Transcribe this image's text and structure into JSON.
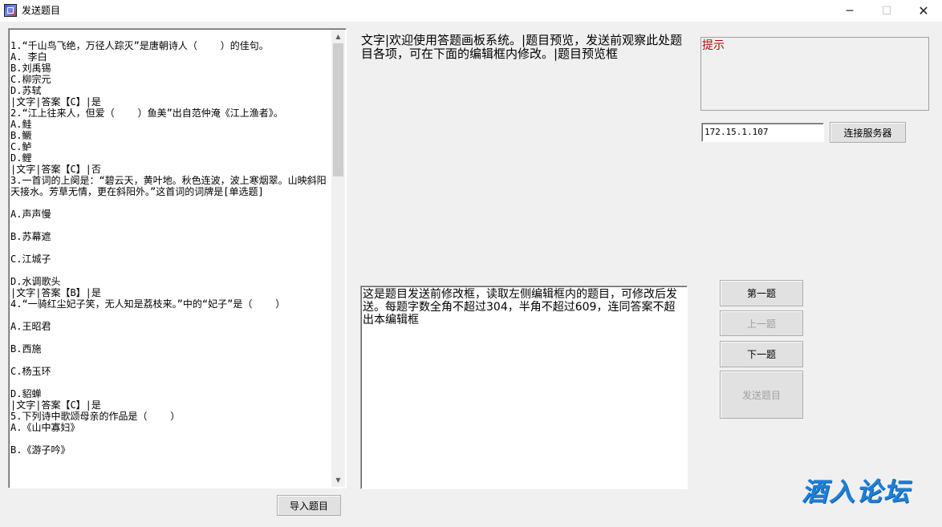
{
  "window": {
    "title": "发送题目",
    "minimize_glyph": "─",
    "maximize_glyph": "☐",
    "close_glyph": "✕",
    "app_icon": "app-icon"
  },
  "question_list": {
    "text": "1.“千山鸟飞绝，万径人踪灭”是唐朝诗人（    ）的佳句。\nA. 李白\nB.刘禹锡\nC.柳宗元\nD.苏轼\n|文字|答案【C】|是\n2.“江上往来人，但爱（    ）鱼美”出自范仲淹《江上渔者》。\nA.鲑\nB.鳜\nC.鲈\nD.鲤\n|文字|答案【C】|否\n3.一首词的上阕是：“碧云天，黄叶地。秋色连波，波上寒烟翠。山映斜阳天接水。芳草无情，更在斜阳外。”这首词的词牌是[单选题]\n\nA.声声慢\n\nB.苏幕遮\n\nC.江城子\n\nD.水调歌头\n|文字|答案【B】|是\n4.“一骑红尘妃子笑，无人知是荔枝来。”中的“妃子”是（    ）\n\nA.王昭君\n\nB.西施\n\nC.杨玉环\n\nD.貂蝉\n|文字|答案【C】|是\n5.下列诗中歌颂母亲的作品是（    ）\nA.《山中寡妇》\n\nB.《游子吟》"
  },
  "scrollbar": {
    "up_glyph": "▲",
    "down_glyph": "▼"
  },
  "import_button": {
    "label": "导入题目"
  },
  "info": {
    "text": "文字|欢迎使用答题画板系统。|题目预览，发送前观察此处题目各项，可在下面的编辑框内修改。|题目预览框"
  },
  "hint": {
    "label": "提示"
  },
  "server": {
    "ip": "172.15.1.107",
    "connect_label": "连接服务器"
  },
  "editor": {
    "text": "这是题目发送前修改框，读取左侧编辑框内的题目，可修改后发送。每题字数全角不超过304，半角不超过609，连同答案不超出本编辑框"
  },
  "nav": {
    "first_label": "第一题",
    "prev_label": "上一题",
    "next_label": "下一题",
    "send_label": "发送题目"
  },
  "watermark": {
    "text": "酒入论坛"
  },
  "colors": {
    "hint_red": "#c00000",
    "watermark_blue": "#1f7fd6",
    "window_bg": "#f0f0f0"
  }
}
